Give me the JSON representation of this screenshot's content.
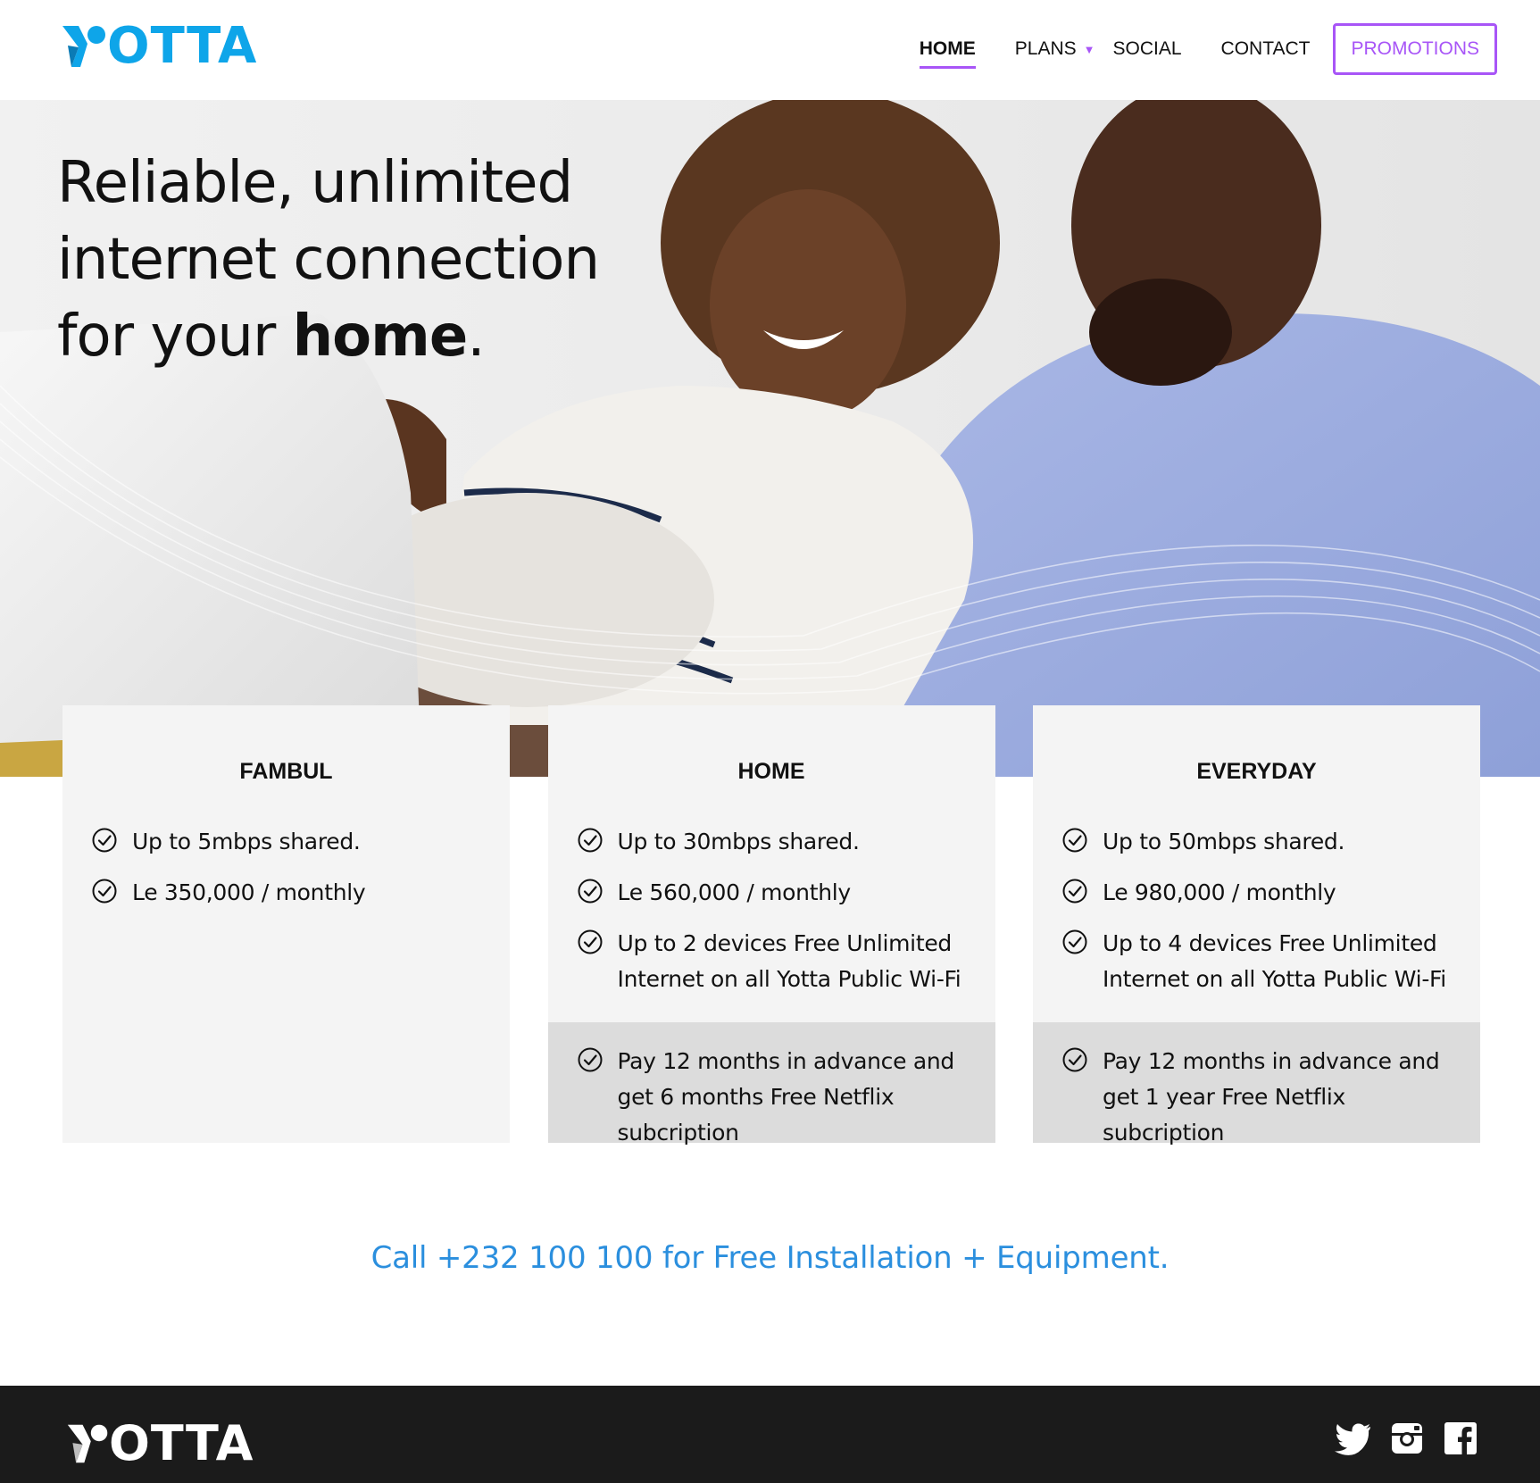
{
  "brand": {
    "name": "OTTA",
    "color": "#0ea5e9",
    "accent": "#a855f7"
  },
  "nav": {
    "items": [
      {
        "label": "HOME",
        "active": true
      },
      {
        "label": "PLANS"
      },
      {
        "label": "SOCIAL"
      },
      {
        "label": "CONTACT"
      }
    ],
    "promotions_label": "PROMOTIONS"
  },
  "hero": {
    "line1": "Reliable, unlimited",
    "line2": "internet connection",
    "line3_prefix": "for your ",
    "line3_bold": "home",
    "line3_suffix": "."
  },
  "plans": [
    {
      "title": "FAMBUL",
      "features": [
        "Up to 5mbps shared.",
        "Le 350,000 / monthly"
      ]
    },
    {
      "title": "HOME",
      "features": [
        "Up to 30mbps shared.",
        "Le 560,000 / monthly",
        "Up to 2 devices Free Unlimited Internet on all Yotta Public Wi-Fi"
      ],
      "promo": "Pay 12 months in advance and get 6 months Free Netflix subcription"
    },
    {
      "title": "EVERYDAY",
      "features": [
        "Up to 50mbps shared.",
        "Le 980,000 / monthly",
        "Up to 4 devices Free Unlimited Internet on all Yotta Public Wi-Fi"
      ],
      "promo": "Pay 12 months in advance and get 1 year Free Netflix subcription"
    }
  ],
  "call_to_action": "Call +232 100 100 for Free Installation + Equipment.",
  "footer": {
    "brand_name": "OTTA",
    "social_icons": [
      "twitter-icon",
      "instagram-icon",
      "facebook-icon"
    ]
  }
}
